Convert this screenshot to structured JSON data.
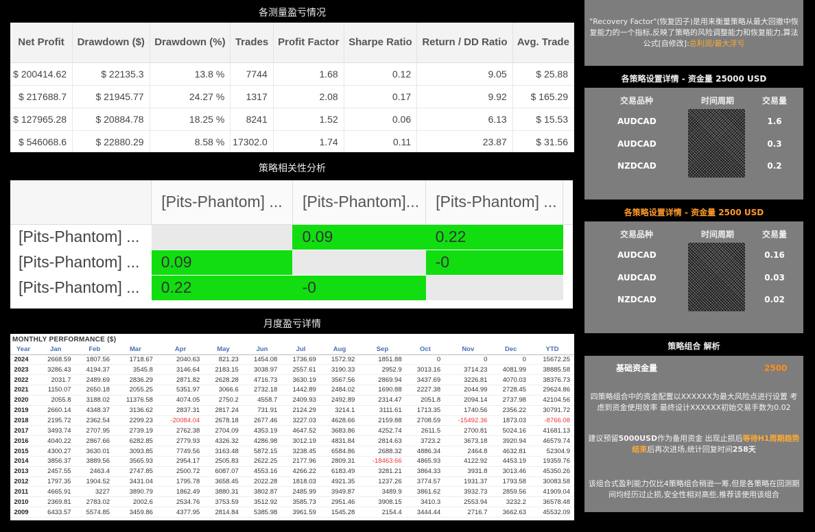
{
  "stats_title": "各测量盈亏情况",
  "stats": {
    "headers": [
      "Net Profit",
      "Drawdown ($)",
      "Drawdown (%)",
      "Trades",
      "Profit Factor",
      "Sharpe Ratio",
      "Return / DD Ratio",
      "Avg. Trade"
    ],
    "rows": [
      [
        "$ 200414.62",
        "$ 22135.3",
        "13.8 %",
        "7744",
        "1.68",
        "0.12",
        "9.05",
        "$ 25.88"
      ],
      [
        "$ 217688.7",
        "$ 21945.77",
        "24.27 %",
        "1317",
        "2.08",
        "0.17",
        "9.92",
        "$ 165.29"
      ],
      [
        "$ 127965.28",
        "$ 20884.78",
        "18.25 %",
        "8241",
        "1.52",
        "0.06",
        "6.13",
        "$ 15.53"
      ],
      [
        "$ 546068.6",
        "$ 22880.29",
        "8.58 %",
        "17302.0",
        "1.74",
        "0.11",
        "23.87",
        "$ 31.56"
      ]
    ]
  },
  "corr_title": "策略相关性分析",
  "corr": {
    "col_headers": [
      "[Pits-Phantom] ...",
      "[Pits-Phantom]...",
      "[Pits-Phantom] ..."
    ],
    "rows": [
      {
        "label": "[Pits-Phantom] ...",
        "cells": [
          "",
          "0.09",
          "0.22"
        ]
      },
      {
        "label": "[Pits-Phantom] ...",
        "cells": [
          "0.09",
          "",
          "-0"
        ]
      },
      {
        "label": "[Pits-Phantom] ...",
        "cells": [
          "0.22",
          "-0",
          ""
        ]
      }
    ]
  },
  "monthly_title": "月度盈亏详情",
  "monthly": {
    "heading": "MONTHLY PERFORMANCE ($)",
    "columns": [
      "Year",
      "Jan",
      "Feb",
      "Mar",
      "Apr",
      "May",
      "Jun",
      "Jul",
      "Aug",
      "Sep",
      "Oct",
      "Nov",
      "Dec",
      "YTD"
    ],
    "rows": [
      [
        "2024",
        "2668.59",
        "1807.56",
        "1718.67",
        "2040.63",
        "821.23",
        "1454.08",
        "1736.69",
        "1572.92",
        "1851.88",
        "0",
        "0",
        "0",
        "15672.25"
      ],
      [
        "2023",
        "3286.43",
        "4194.37",
        "3545.8",
        "3146.64",
        "2183.15",
        "3038.97",
        "2557.61",
        "3190.33",
        "2952.9",
        "3013.16",
        "3714.23",
        "4081.99",
        "38885.58"
      ],
      [
        "2022",
        "2031.7",
        "2489.69",
        "2836.29",
        "2871.82",
        "2628.28",
        "4716.73",
        "3630.19",
        "3567.56",
        "2869.94",
        "3437.69",
        "3226.81",
        "4070.03",
        "38376.73"
      ],
      [
        "2021",
        "1150.07",
        "2650.18",
        "2055.25",
        "5351.97",
        "3066.6",
        "2732.18",
        "1442.89",
        "2484.02",
        "1690.88",
        "2227.38",
        "2044.99",
        "2728.45",
        "29624.86"
      ],
      [
        "2020",
        "2055.8",
        "3188.02",
        "11376.58",
        "4074.05",
        "2750.2",
        "4558.7",
        "2409.93",
        "2492.89",
        "2314.47",
        "2051.8",
        "2094.14",
        "2737.98",
        "42104.56"
      ],
      [
        "2019",
        "2660.14",
        "4348.37",
        "3136.62",
        "2837.31",
        "2817.24",
        "731.91",
        "2124.29",
        "3214.1",
        "3111.61",
        "1713.35",
        "1740.56",
        "2356.22",
        "30791.72"
      ],
      [
        "2018",
        "2195.72",
        "2362.54",
        "2299.23",
        "-20084.04",
        "2678.18",
        "2677.46",
        "3227.03",
        "4628.66",
        "2159.88",
        "2708.59",
        "-15492.36",
        "1873.03",
        "-8766.08"
      ],
      [
        "2017",
        "3493.74",
        "2707.95",
        "2739.19",
        "2762.38",
        "2704.09",
        "4353.19",
        "4647.52",
        "3683.86",
        "4252.74",
        "2611.5",
        "2700.81",
        "5024.16",
        "41681.13"
      ],
      [
        "2016",
        "4040.22",
        "2867.66",
        "6282.85",
        "2779.93",
        "4326.32",
        "4286.98",
        "3012.19",
        "4831.84",
        "2814.63",
        "3723.2",
        "3673.18",
        "3920.94",
        "46579.74"
      ],
      [
        "2015",
        "4300.27",
        "3630.01",
        "3093.85",
        "7749.56",
        "3163.48",
        "5872.15",
        "3238.45",
        "6584.86",
        "2688.32",
        "4886.34",
        "2464.8",
        "4632.81",
        "52304.9"
      ],
      [
        "2014",
        "3856.37",
        "3889.56",
        "3565.93",
        "2954.17",
        "2505.83",
        "2622.25",
        "2177.96",
        "2809.31",
        "-18463.66",
        "4865.93",
        "4122.92",
        "4453.19",
        "19359.76"
      ],
      [
        "2013",
        "2457.55",
        "2463.4",
        "2747.85",
        "2500.72",
        "6087.07",
        "4553.16",
        "4266.22",
        "6183.49",
        "3281.21",
        "3864.33",
        "3931.8",
        "3013.46",
        "45350.26"
      ],
      [
        "2012",
        "1797.35",
        "1904.52",
        "3431.04",
        "1795.78",
        "3658.45",
        "2022.28",
        "1818.03",
        "4921.35",
        "1237.26",
        "3774.57",
        "1931.37",
        "1793.58",
        "30083.58"
      ],
      [
        "2011",
        "4665.91",
        "3227",
        "3890.79",
        "1862.49",
        "3880.31",
        "3802.87",
        "2485.99",
        "3949.87",
        "3489.9",
        "3861.62",
        "3932.73",
        "2859.56",
        "41909.04"
      ],
      [
        "2010",
        "2369.81",
        "2783.02",
        "2002.6",
        "2534.76",
        "3753.59",
        "3512.92",
        "3585.73",
        "2951.46",
        "3908.15",
        "3410.3",
        "2553.94",
        "3232.2",
        "36578.48"
      ],
      [
        "2009",
        "6433.57",
        "5574.85",
        "3459.86",
        "4377.95",
        "2814.84",
        "5385.98",
        "3961.59",
        "1545.28",
        "2154.4",
        "3444.44",
        "2716.7",
        "3662.63",
        "45532.09"
      ]
    ]
  },
  "note": {
    "text": "\"Recovery Factor\"(恢复因子)是用来衡量策略从最大回撤中恢复能力的一个指标,反映了策略的风险调整能力和恢复能力,算法公式[自修改]:",
    "formula": "总利润/最大浮亏"
  },
  "settings1": {
    "title": "各策略设置详情 - 资金量 25000 USD",
    "headers": [
      "交易品种",
      "时间周期",
      "交易量"
    ],
    "rows": [
      [
        "AUDCAD",
        "1.6"
      ],
      [
        "AUDCAD",
        "0.3"
      ],
      [
        "NZDCAD",
        "0.2"
      ]
    ]
  },
  "settings2": {
    "title": "各策略设置详情 - 资金量 2500 USD",
    "headers": [
      "交易品种",
      "时间周期",
      "交易量"
    ],
    "rows": [
      [
        "AUDCAD",
        "0.16"
      ],
      [
        "AUDCAD",
        "0.03"
      ],
      [
        "NZDCAD",
        "0.02"
      ]
    ]
  },
  "combo": {
    "title": "策略组合 解析",
    "base_label": "基础资金量",
    "base_value": "2500",
    "p1": "四策略组合中的资金配置以XXXXXX为最大风险点进行设置 考虑到资金使用效率 最终设计XXXXXX初始交易手数为0.02",
    "p2_a": "建议预留",
    "p2_b": "5000USD",
    "p2_c": "作为备用资金 出现止损后",
    "p2_d": "等待H1周期趋势结束",
    "p2_e": "后再次进场,统计回复时间",
    "p2_f": "258天",
    "p3": "该组合式盈利能力仅比4策略组合稍逊一筹,但是各策略在回测期间均经历过止损,安全性相对高些,推荐该使用该组合"
  },
  "colors": {
    "green": "#11dd11",
    "orange": "#ffaa33",
    "panel": "#7d7d7d"
  }
}
